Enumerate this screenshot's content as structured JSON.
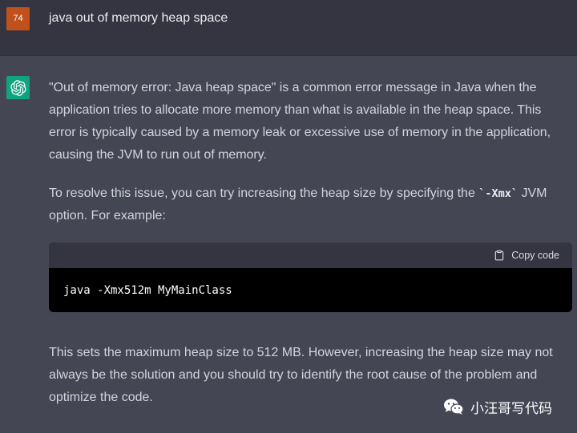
{
  "user": {
    "avatar_label": "74",
    "message": "java out of memory heap space"
  },
  "assistant": {
    "avatar_icon": "openai-logo-icon",
    "para1": "\"Out of memory error: Java heap space\" is a common error message in Java when the application tries to allocate more memory than what is available in the heap space. This error is typically caused by a memory leak or excessive use of memory in the application, causing the JVM to run out of memory.",
    "para2_before": "To resolve this issue, you can try increasing the heap size by specifying the ",
    "para2_code": "`-Xmx`",
    "para2_after": " JVM option. For example:",
    "code_block": {
      "copy_label": "Copy code",
      "copy_icon": "clipboard-icon",
      "code": "java -Xmx512m MyMainClass"
    },
    "para3": "This sets the maximum heap size to 512 MB. However, increasing the heap size may not always be the solution and you should try to identify the root cause of the problem and optimize the code."
  },
  "watermark": {
    "icon": "wechat-icon",
    "text": "小汪哥写代码"
  },
  "colors": {
    "user_bg": "#343541",
    "assistant_bg": "#444654",
    "user_avatar": "#c1511c",
    "gpt_avatar": "#10a37f",
    "code_bg": "#000000"
  }
}
